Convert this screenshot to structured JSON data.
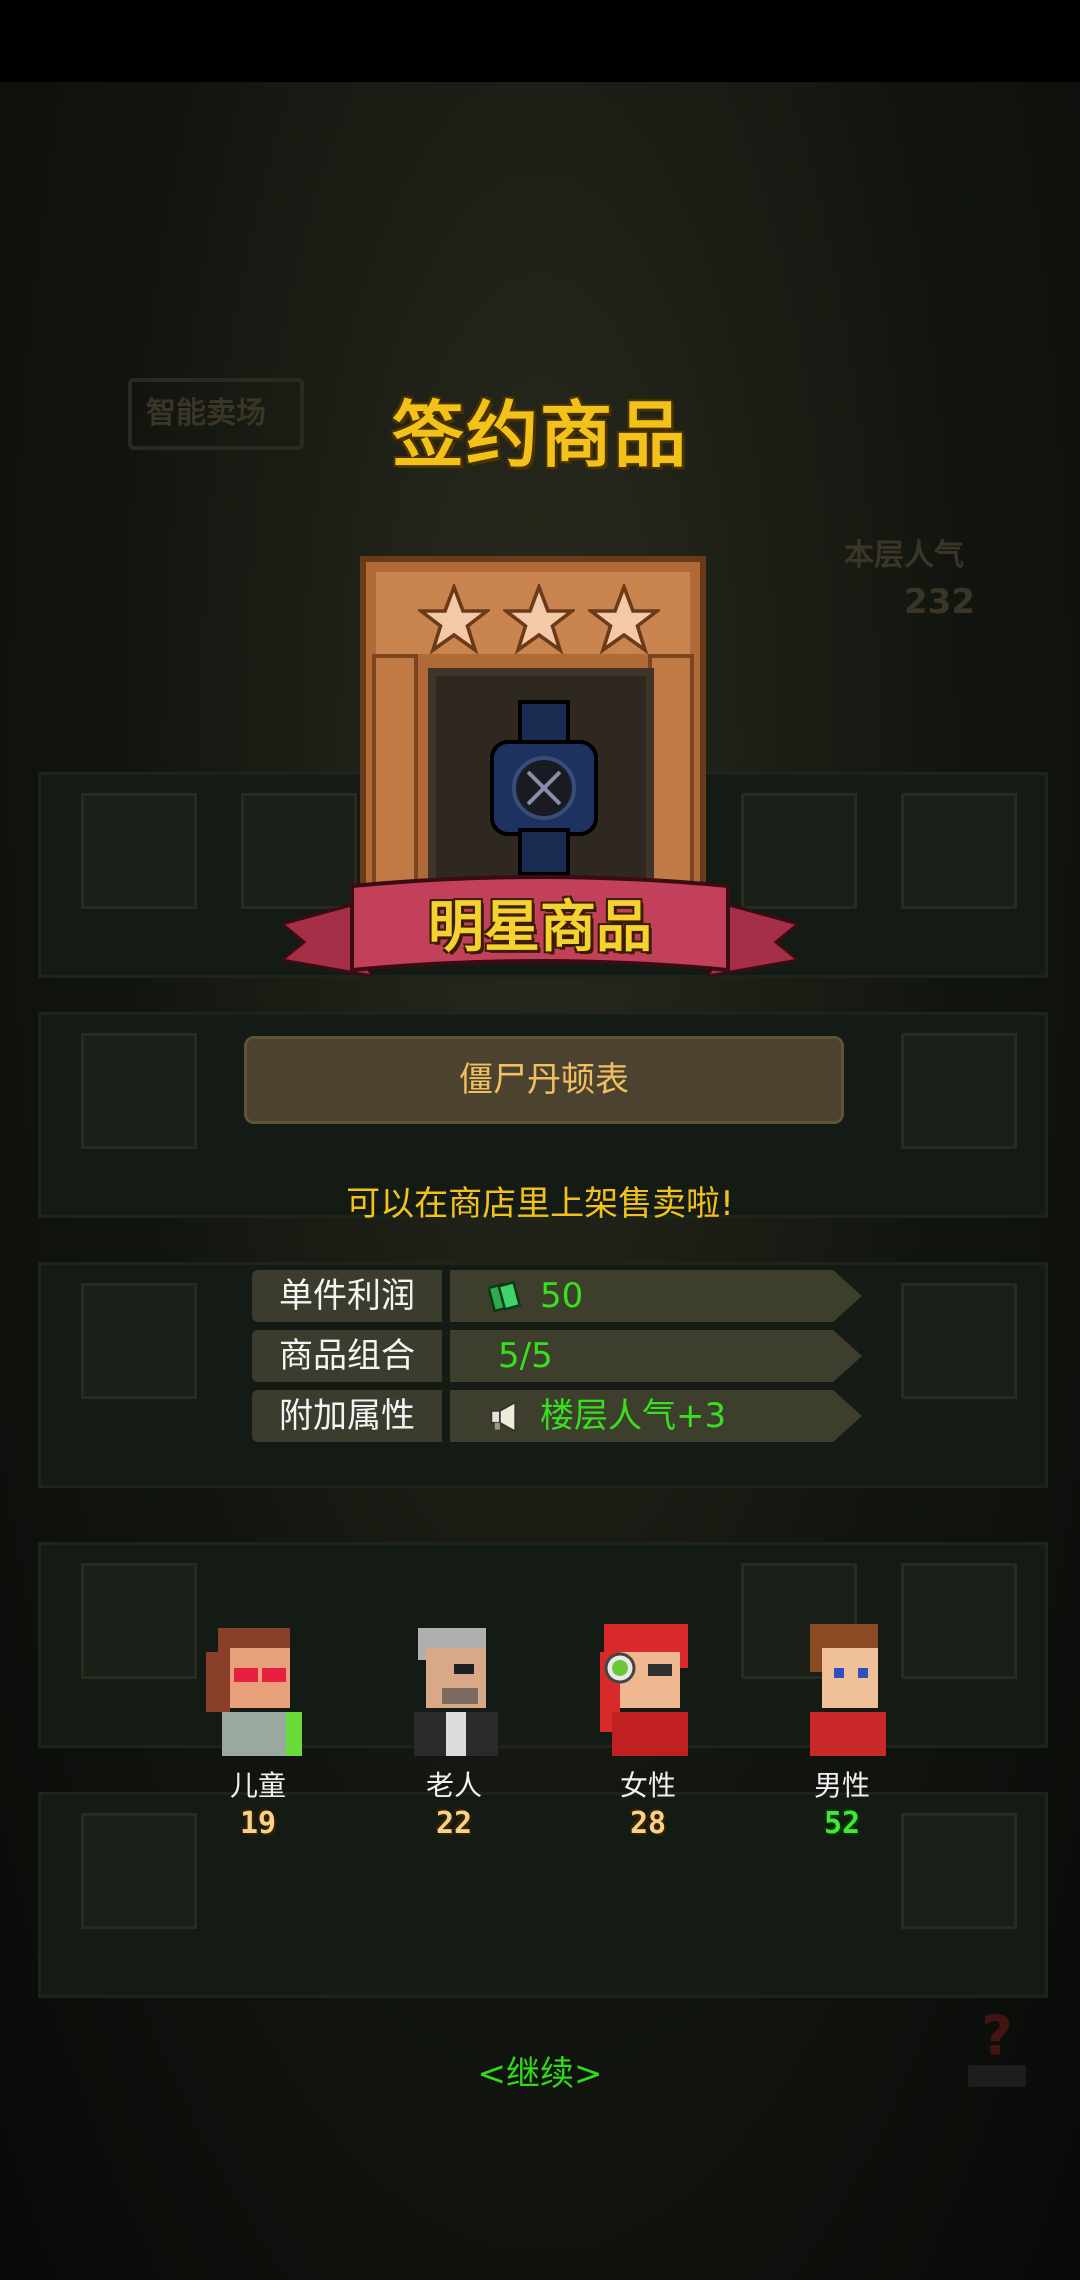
{
  "title": "签约商品",
  "background": {
    "shop_sign": "智能卖场",
    "floor_popularity_label": "本层人气",
    "floor_popularity_value": "232"
  },
  "card": {
    "stars": 3,
    "badge": "明星商品",
    "item_icon": "watch-icon"
  },
  "item_name": "僵尸丹顿表",
  "description": "可以在商店里上架售卖啦!",
  "stats": [
    {
      "key": "单件利润",
      "value": "50",
      "icon": "money-icon"
    },
    {
      "key": "商品组合",
      "value": "5/5",
      "icon": ""
    },
    {
      "key": "附加属性",
      "value": "楼层人气+3",
      "icon": "megaphone-icon"
    }
  ],
  "customers": [
    {
      "label": "儿童",
      "count": "19"
    },
    {
      "label": "老人",
      "count": "22"
    },
    {
      "label": "女性",
      "count": "28"
    },
    {
      "label": "男性",
      "count": "52"
    }
  ],
  "continue_label": "<继续>",
  "colors": {
    "title": "#f2c21a",
    "value_green": "#37e01f",
    "continue_green": "#31d81c",
    "ribbon": "#c2405a"
  }
}
